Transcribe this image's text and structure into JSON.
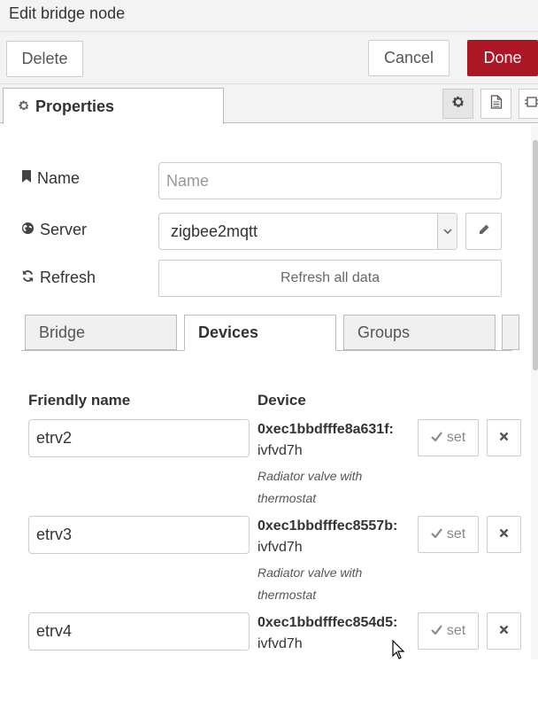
{
  "header": {
    "title": "Edit bridge node"
  },
  "actions": {
    "delete_label": "Delete",
    "cancel_label": "Cancel",
    "done_label": "Done"
  },
  "tabs": {
    "properties_label": "Properties",
    "icons": [
      "gear-icon",
      "document-icon",
      "node-frame-icon"
    ]
  },
  "form": {
    "name_label": "Name",
    "name_placeholder": "Name",
    "server_label": "Server",
    "server_value": "zigbee2mqtt",
    "refresh_label": "Refresh",
    "refresh_button": "Refresh all data"
  },
  "subtabs": {
    "bridge": "Bridge",
    "devices": "Devices",
    "groups": "Groups",
    "active": "Devices"
  },
  "devices_table": {
    "col_friendly": "Friendly name",
    "col_device": "Device",
    "set_label": "set",
    "rows": [
      {
        "friendly_name": "etrv2",
        "address": "0xec1bbdfffe8a631f:",
        "model": "ivfvd7h",
        "description": "Radiator valve with thermostat"
      },
      {
        "friendly_name": "etrv3",
        "address": "0xec1bbdfffec8557b:",
        "model": "ivfvd7h",
        "description": "Radiator valve with thermostat"
      },
      {
        "friendly_name": "etrv4",
        "address": "0xec1bbdfffec854d5:",
        "model": "ivfvd7h",
        "description": ""
      }
    ]
  },
  "colors": {
    "done_button": "#ad1625",
    "panel_bg": "#f3f3f3",
    "border": "#cccccc"
  }
}
